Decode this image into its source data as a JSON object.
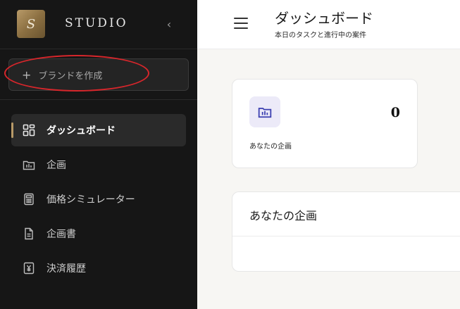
{
  "sidebar": {
    "logo_letter": "S",
    "brand_name": "STUDIO",
    "collapse_icon": "chevron-left-icon",
    "create_brand_label": "ブランドを作成",
    "nav_items": [
      {
        "label": "ダッシュボード",
        "icon": "dashboard-grid-icon",
        "active": true
      },
      {
        "label": "企画",
        "icon": "folder-chart-icon",
        "active": false
      },
      {
        "label": "価格シミュレーター",
        "icon": "calculator-icon",
        "active": false
      },
      {
        "label": "企画書",
        "icon": "document-icon",
        "active": false
      },
      {
        "label": "決済履歴",
        "icon": "yen-receipt-icon",
        "active": false
      }
    ],
    "accent_color": "#b89a68"
  },
  "header": {
    "title": "ダッシュボード",
    "subtitle": "本日のタスクと進行中の案件"
  },
  "stat_card": {
    "value": "0",
    "label": "あなたの企画",
    "icon": "folder-chart-icon",
    "icon_color": "#3b3fb0"
  },
  "plans_panel": {
    "title": "あなたの企画"
  },
  "annotation": {
    "color": "#d7262b"
  }
}
